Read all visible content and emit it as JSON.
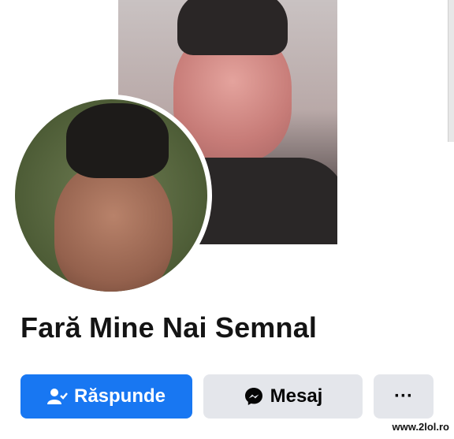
{
  "profile": {
    "name": "Fară Mine Nai Semnal"
  },
  "actions": {
    "reply_label": "Răspunde",
    "message_label": "Mesaj",
    "more_label": "···"
  },
  "watermark": {
    "text": "www.2lol.ro"
  },
  "colors": {
    "primary": "#1877f2",
    "secondary": "#e4e6eb"
  },
  "icons": {
    "reply": "person-check-icon",
    "message": "messenger-icon",
    "more": "ellipsis-icon"
  }
}
